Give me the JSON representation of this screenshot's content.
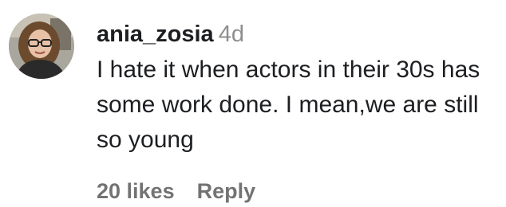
{
  "comment": {
    "avatar_icon": "user-avatar-photo",
    "username": "ania_zosia",
    "timestamp": "4d",
    "text": "I hate it when actors in their 30s has some work done. I mean,we are still so young",
    "likes": "20 likes",
    "reply_label": "Reply"
  }
}
